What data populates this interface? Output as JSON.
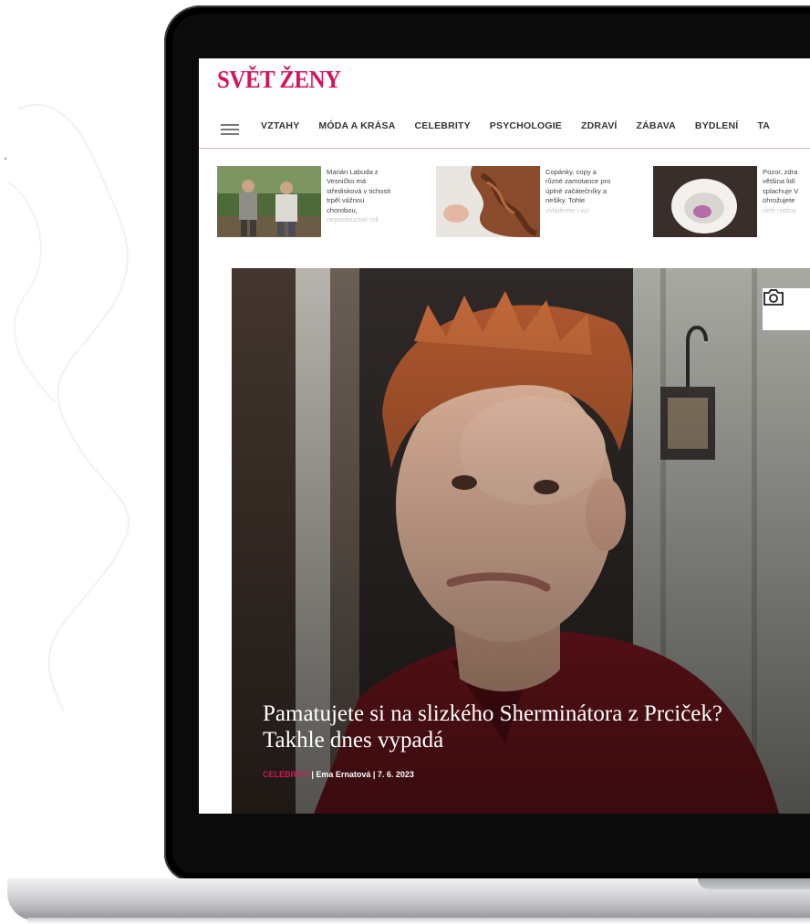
{
  "site": {
    "logo": "SVĚT ŽENY",
    "brand_color": "#d5135c"
  },
  "nav": {
    "menu_icon": "hamburger-icon",
    "items": [
      "VZTAHY",
      "MÓDA A KRÁSA",
      "CELEBRITY",
      "PSYCHOLOGIE",
      "ZDRAVÍ",
      "ZÁBAVA",
      "BYDLENÍ",
      "TA"
    ]
  },
  "teasers": [
    {
      "lines": [
        "Marián Labuda z",
        "Vesničko má",
        "středisková v tichosti",
        "trpěl vážnou",
        "chorobou,"
      ],
      "fade": "neposlouchal roli"
    },
    {
      "lines": [
        "Copánky, copy a",
        "různé zamotance pro",
        "úplné začátečníky a",
        "nešiky. Tohle"
      ],
      "fade": "zvládnete i vy!"
    },
    {
      "lines": [
        "Pozor, zdra",
        "většina lidí",
        "splachuje V",
        "ohrožujete"
      ],
      "fade": "celé rodiny"
    }
  ],
  "hero": {
    "title": "Pamatujete si na slizkého Sherminátora z Prciček? Takhle dnes vypadá",
    "category": "CELEBRITY",
    "meta": " | Ema Ernatová | 7. 6. 2023",
    "gallery_icon": "camera-icon"
  }
}
